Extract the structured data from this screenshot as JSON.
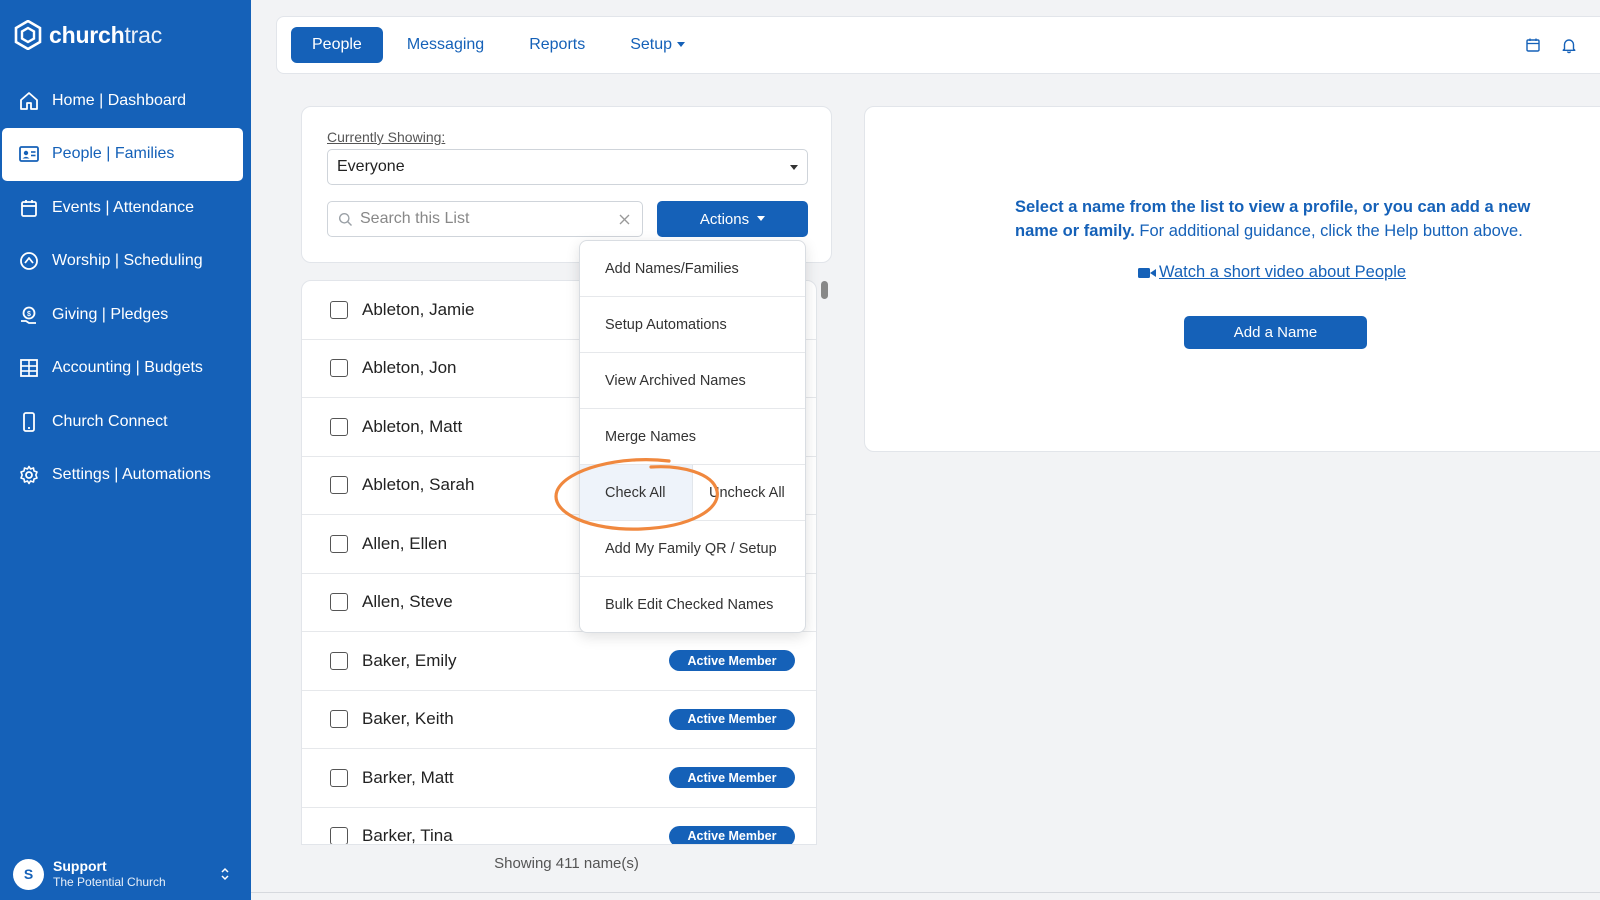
{
  "app": {
    "brand_bold": "church",
    "brand_light": "trac"
  },
  "sidebar": {
    "items": [
      {
        "label": "Home | Dashboard",
        "icon": "home-icon",
        "active": false
      },
      {
        "label": "People | Families",
        "icon": "person-card-icon",
        "active": true
      },
      {
        "label": "Events | Attendance",
        "icon": "calendar-icon",
        "active": false
      },
      {
        "label": "Worship | Scheduling",
        "icon": "worship-icon",
        "active": false
      },
      {
        "label": "Giving | Pledges",
        "icon": "giving-icon",
        "active": false
      },
      {
        "label": "Accounting | Budgets",
        "icon": "grid-icon",
        "active": false
      },
      {
        "label": "Church Connect",
        "icon": "phone-icon",
        "active": false
      },
      {
        "label": "Settings | Automations",
        "icon": "gear-icon",
        "active": false
      }
    ],
    "user": {
      "initial": "S",
      "name": "Support",
      "org": "The Potential Church"
    }
  },
  "topbar": {
    "tabs": [
      {
        "label": "People",
        "active": true
      },
      {
        "label": "Messaging",
        "active": false
      },
      {
        "label": "Reports",
        "active": false
      },
      {
        "label": "Setup",
        "active": false,
        "has_caret": true
      }
    ]
  },
  "filter": {
    "label": "Currently Showing:",
    "selected": "Everyone",
    "search_placeholder": "Search this List",
    "actions_label": "Actions"
  },
  "actions_menu": {
    "items": [
      "Add Names/Families",
      "Setup Automations",
      "View Archived Names",
      "Merge Names"
    ],
    "check_all": "Check All",
    "uncheck_all": "Uncheck All",
    "items_after": [
      "Add My Family QR / Setup",
      "Bulk Edit Checked Names"
    ]
  },
  "people_list": {
    "rows": [
      {
        "name": "Ableton, Jamie",
        "badge": ""
      },
      {
        "name": "Ableton, Jon",
        "badge": ""
      },
      {
        "name": "Ableton, Matt",
        "badge": ""
      },
      {
        "name": "Ableton, Sarah",
        "badge": ""
      },
      {
        "name": "Allen, Ellen",
        "badge": ""
      },
      {
        "name": "Allen, Steve",
        "badge": ""
      },
      {
        "name": "Baker, Emily",
        "badge": "Active Member"
      },
      {
        "name": "Baker, Keith",
        "badge": "Active Member"
      },
      {
        "name": "Barker, Matt",
        "badge": "Active Member"
      },
      {
        "name": "Barker, Tina",
        "badge": "Active Member"
      }
    ],
    "showing": "Showing 411 name(s)"
  },
  "info_panel": {
    "bold_text": "Select a name from the list to view a profile, or you can add a new name or family.",
    "normal_text": " For additional guidance, click the Help button above.",
    "video_link": " Watch a short video about People",
    "add_button": "Add a Name"
  },
  "colors": {
    "brand_blue": "#1561b8",
    "highlight_orange": "#f0883e",
    "accent_orange": "#f39a3e"
  }
}
